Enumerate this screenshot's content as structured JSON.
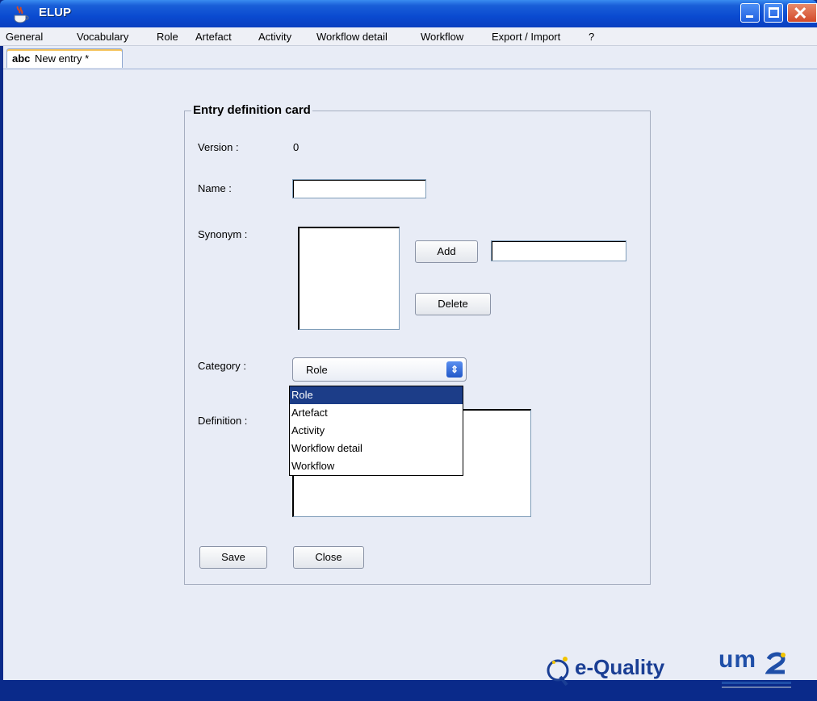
{
  "window": {
    "title": "ELUP",
    "app_icon": "java-cup-icon",
    "colors": {
      "titlebar": "#0a4ad0",
      "close_button": "#d24a2a",
      "selection": "#1c3d88"
    }
  },
  "menu": {
    "items": [
      "General",
      "Vocabulary",
      "Role",
      "Artefact",
      "Activity",
      "Workflow detail",
      "Workflow",
      "Export / Import",
      "?"
    ]
  },
  "tab": {
    "prefix": "abc",
    "label": "New entry *"
  },
  "card": {
    "title": "Entry definition card",
    "version_label": "Version :",
    "version_value": "0",
    "name_label": "Name :",
    "name_value": "",
    "synonym_label": "Synonym :",
    "synonym_input_value": "",
    "add_label": "Add",
    "delete_label": "Delete",
    "category_label": "Category :",
    "category_value": "Role",
    "category_options": [
      "Role",
      "Artefact",
      "Activity",
      "Workflow detail",
      "Workflow"
    ],
    "definition_label": "Definition :",
    "save_label": "Save",
    "close_label": "Close"
  },
  "logos": {
    "eq_text": "e-Quality",
    "um_text": "um"
  }
}
